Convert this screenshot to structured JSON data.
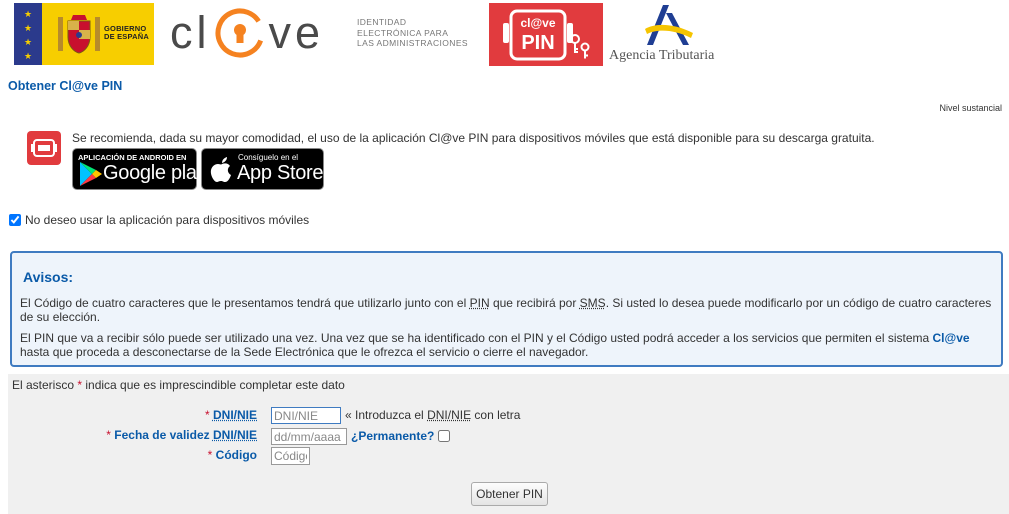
{
  "header": {
    "gobierno_text_line1": "GOBIERNO",
    "gobierno_text_line2": "DE ESPAÑA",
    "clave_left": "cl",
    "clave_right": "ve",
    "clave_tagline_line1": "IDENTIDAD",
    "clave_tagline_line2": "ELECTRÓNICA PARA",
    "clave_tagline_line3": "LAS ADMINISTRACIONES",
    "pin_logo_top": "cl@ve",
    "pin_logo_bottom": "PIN",
    "aeat_text": "Agencia Tributaria"
  },
  "page": {
    "title": "Obtener Cl@ve PIN",
    "level": "Nivel sustancial"
  },
  "app": {
    "recommendation": "Se recomienda, dada su mayor comodidad, el uso de la aplicación Cl@ve PIN para dispositivos móviles que está disponible para su descarga gratuita.",
    "google_small": "APLICACIÓN DE ANDROID EN",
    "google_big": "Google play",
    "apple_small": "Consíguelo en el",
    "apple_big": "App Store",
    "no_app_label": "No deseo usar la aplicación para dispositivos móviles"
  },
  "avisos": {
    "title": "Avisos:",
    "p1_a": "El Código de cuatro caracteres que le presentamos tendrá que utilizarlo junto con el ",
    "p1_pin": "PIN",
    "p1_b": " que recibirá por ",
    "p1_sms": "SMS",
    "p1_c": ". Si usted lo desea puede modificarlo por un código de cuatro caracteres de su elección.",
    "p2_a": "El PIN que va a recibir sólo puede ser utilizado una vez. Una vez que se ha identificado con el PIN y el Código usted podrá acceder a los servicios que permiten el sistema ",
    "p2_clave": "Cl@ve",
    "p2_b": " hasta que proceda a desconectarse de la Sede Electrónica que le ofrezca el servicio o cierre el navegador."
  },
  "form": {
    "required_note_a": "El asterisco ",
    "required_star": "*",
    "required_note_b": " indica que es imprescindible completar este dato",
    "dni_label": "DNI/NIE",
    "dni_placeholder": "DNI/NIE",
    "dni_hint_a": "« Introduzca el ",
    "dni_hint_u": "DNI/NIE",
    "dni_hint_b": " con letra",
    "fecha_label_a": "Fecha de validez ",
    "fecha_label_u": "DNI/NIE",
    "fecha_placeholder": "dd/mm/aaaa",
    "permanente_label": "¿Permanente?",
    "codigo_label": "Código",
    "codigo_placeholder": "Código",
    "submit_label": "Obtener PIN"
  },
  "colors": {
    "title_blue": "#0a5aa8",
    "pin_red": "#e13b3e",
    "clave_orange": "#f58220",
    "avisos_border": "#3f7bc1",
    "avisos_bg": "#eef4fb",
    "required_red": "#c8102e"
  }
}
